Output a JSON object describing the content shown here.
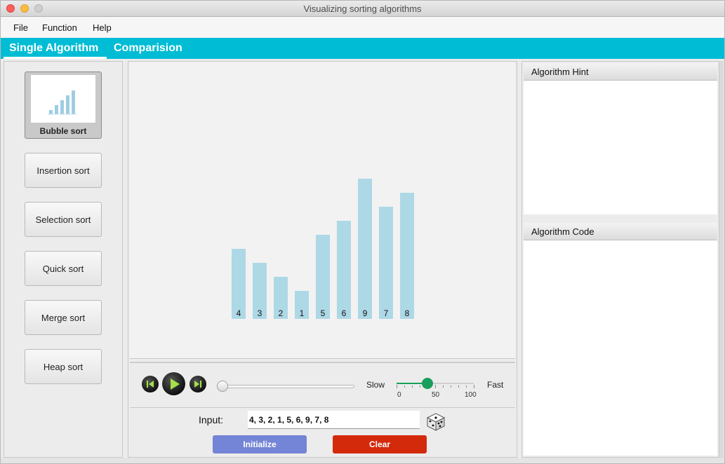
{
  "window": {
    "title": "Visualizing sorting algorithms"
  },
  "menu": {
    "items": [
      "File",
      "Function",
      "Help"
    ]
  },
  "tabs": [
    {
      "label": "Single Algorithm",
      "active": true
    },
    {
      "label": "Comparision",
      "active": false
    }
  ],
  "sidebar": {
    "selected": "Bubble sort",
    "items": [
      {
        "label": "Bubble sort",
        "icon": "bar-chart-thumbnail-icon"
      },
      {
        "label": "Insertion sort"
      },
      {
        "label": "Selection sort"
      },
      {
        "label": "Quick sort"
      },
      {
        "label": "Merge sort"
      },
      {
        "label": "Heap sort"
      }
    ]
  },
  "visualization": {
    "bar_color": "#add8e6",
    "values": [
      4,
      3,
      2,
      1,
      5,
      6,
      9,
      7,
      8
    ]
  },
  "playback": {
    "prev_icon": "skip-previous-icon",
    "play_icon": "play-icon",
    "next_icon": "skip-next-icon",
    "progress": 0,
    "speed": {
      "slow_label": "Slow",
      "fast_label": "Fast",
      "value": 40,
      "min": 0,
      "max": 100,
      "tick_labels": [
        "0",
        "50",
        "100"
      ],
      "accent_color": "#1a9e5b"
    }
  },
  "input": {
    "label": "Input:",
    "value": "4, 3, 2, 1, 5, 6, 9, 7, 8",
    "dice_icon": "dice-random-icon",
    "initialize_label": "Initialize",
    "initialize_color": "#7484d6",
    "clear_label": "Clear",
    "clear_color": "#d42a0c"
  },
  "panels": {
    "hint_title": "Algorithm Hint",
    "code_title": "Algorithm Code"
  },
  "colors": {
    "tab_bar": "#00bcd4"
  }
}
